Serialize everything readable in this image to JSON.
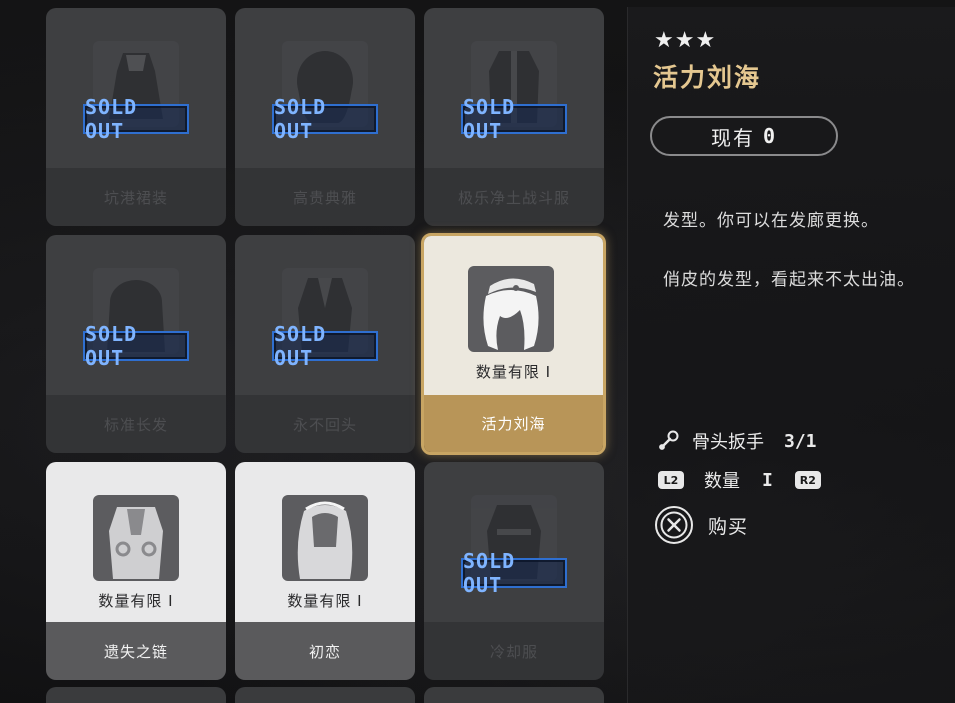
{
  "grid": {
    "cards": [
      {
        "name": "坑港裙装",
        "status": "sold_out",
        "sold_label": "SOLD OUT",
        "icon": "outfit-dress-icon"
      },
      {
        "name": "高贵典雅",
        "status": "sold_out",
        "sold_label": "SOLD OUT",
        "icon": "hairstyle-icon"
      },
      {
        "name": "极乐净土战斗服",
        "status": "sold_out",
        "sold_label": "SOLD OUT",
        "icon": "battle-suit-icon"
      },
      {
        "name": "标准长发",
        "status": "sold_out",
        "sold_label": "SOLD OUT",
        "icon": "long-hair-icon"
      },
      {
        "name": "永不回头",
        "status": "sold_out",
        "sold_label": "SOLD OUT",
        "icon": "outfit-coat-icon"
      },
      {
        "name": "活力刘海",
        "status": "selected",
        "limit_label": "数量有限 I",
        "icon": "bangs-hair-icon"
      },
      {
        "name": "遗失之链",
        "status": "available",
        "limit_label": "数量有限 I",
        "icon": "chain-outfit-icon"
      },
      {
        "name": "初恋",
        "status": "available",
        "limit_label": "数量有限 I",
        "icon": "first-love-hair-icon"
      },
      {
        "name": "冷却服",
        "status": "sold_out",
        "sold_label": "SOLD OUT",
        "icon": "cooling-suit-icon"
      }
    ]
  },
  "detail": {
    "rarity_stars": "★★★",
    "title": "活力刘海",
    "owned_label": "现有",
    "owned_value": "0",
    "description_1": "发型。你可以在发廊更换。",
    "description_2": "俏皮的发型，看起来不太出油。",
    "cost_label": "骨头扳手",
    "cost_value": "3/1",
    "quantity_left_button": "L2",
    "quantity_label": "数量",
    "quantity_value": "I",
    "quantity_right_button": "R2",
    "buy_label": "购买"
  },
  "colors": {
    "selected_border": "#c8a563",
    "title_gold": "#e4c790",
    "sold_out_blue": "#2f6fd0"
  }
}
